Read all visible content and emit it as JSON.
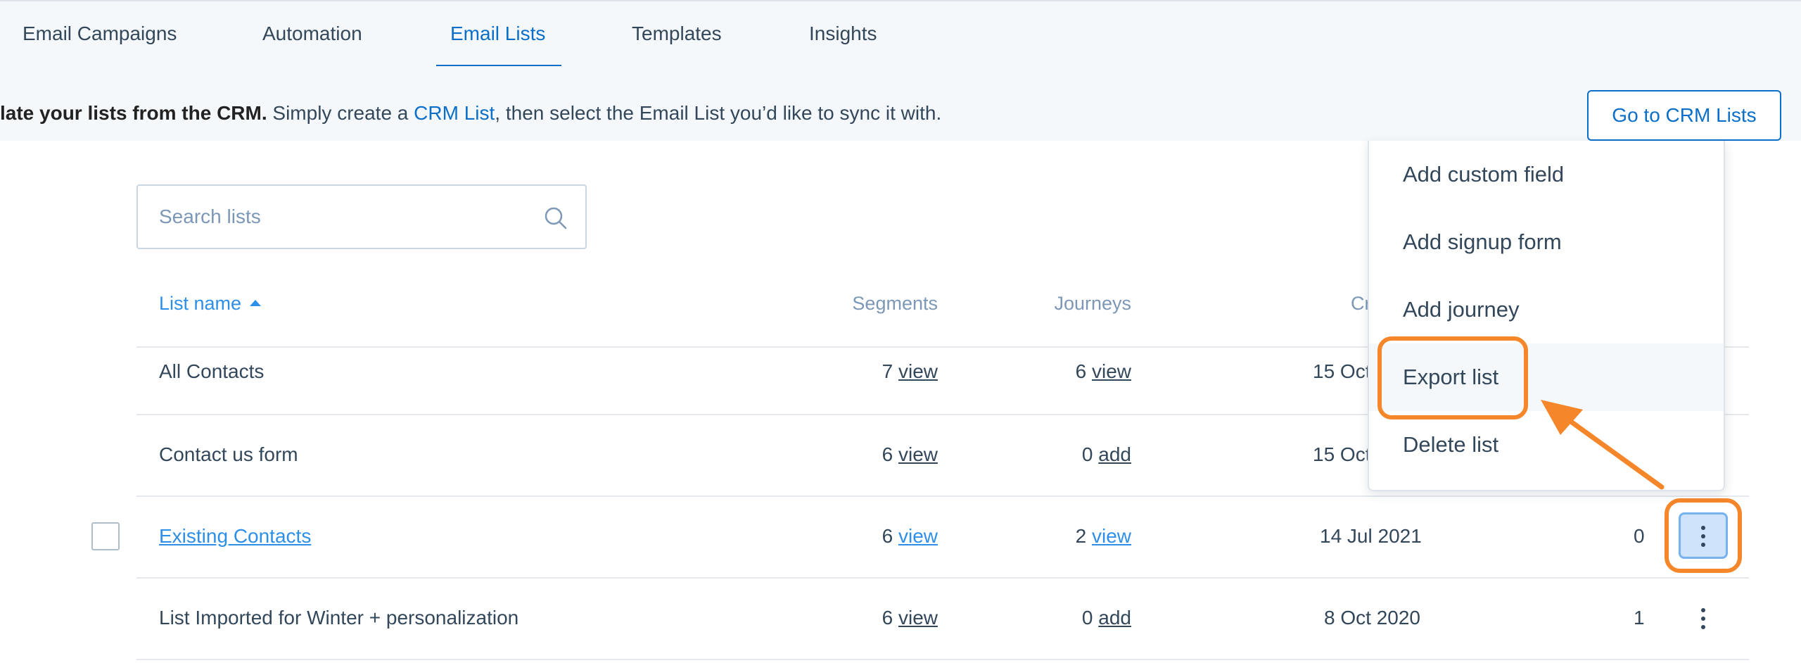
{
  "nav": {
    "tabs": [
      {
        "label": "Email Campaigns"
      },
      {
        "label": "Automation"
      },
      {
        "label": "Email Lists"
      },
      {
        "label": "Templates"
      },
      {
        "label": "Insights"
      }
    ],
    "active_tab": "Email Lists"
  },
  "banner": {
    "bold": "late your lists from the CRM.",
    "text_before_link": " Simply create a ",
    "link": "CRM List",
    "text_after_link": ", then select the Email List you’d like to sync it with.",
    "button": "Go to CRM Lists"
  },
  "search": {
    "placeholder": "Search lists"
  },
  "table": {
    "headers": {
      "list_name": "List name",
      "segments": "Segments",
      "journeys": "Journeys",
      "created": "Cr"
    },
    "rows": [
      {
        "name": "All Contacts",
        "segments_count": "7",
        "segments_action": "view",
        "journeys_count": "6",
        "journeys_action": "view",
        "created": "15 Oct",
        "count": ""
      },
      {
        "name": "Contact us form",
        "segments_count": "6",
        "segments_action": "view",
        "journeys_count": "0",
        "journeys_action": "add",
        "created": "15 Oct",
        "count": ""
      },
      {
        "name": "Existing Contacts",
        "segments_count": "6",
        "segments_action": "view",
        "journeys_count": "2",
        "journeys_action": "view",
        "created": "14 Jul 2021",
        "count": "0"
      },
      {
        "name": "List Imported for Winter + personalization",
        "segments_count": "6",
        "segments_action": "view",
        "journeys_count": "0",
        "journeys_action": "add",
        "created": "8 Oct 2020",
        "count": "1"
      }
    ]
  },
  "dropdown": {
    "items": [
      {
        "label": "Add custom field"
      },
      {
        "label": "Add signup form"
      },
      {
        "label": "Add journey"
      },
      {
        "label": "Export list"
      },
      {
        "label": "Delete list"
      }
    ],
    "highlighted": "Export list"
  },
  "colors": {
    "accent": "#0b6fc9",
    "link": "#2d8fe8",
    "annotation": "#f5862a",
    "text": "#33475b",
    "muted": "#7c98b6"
  }
}
